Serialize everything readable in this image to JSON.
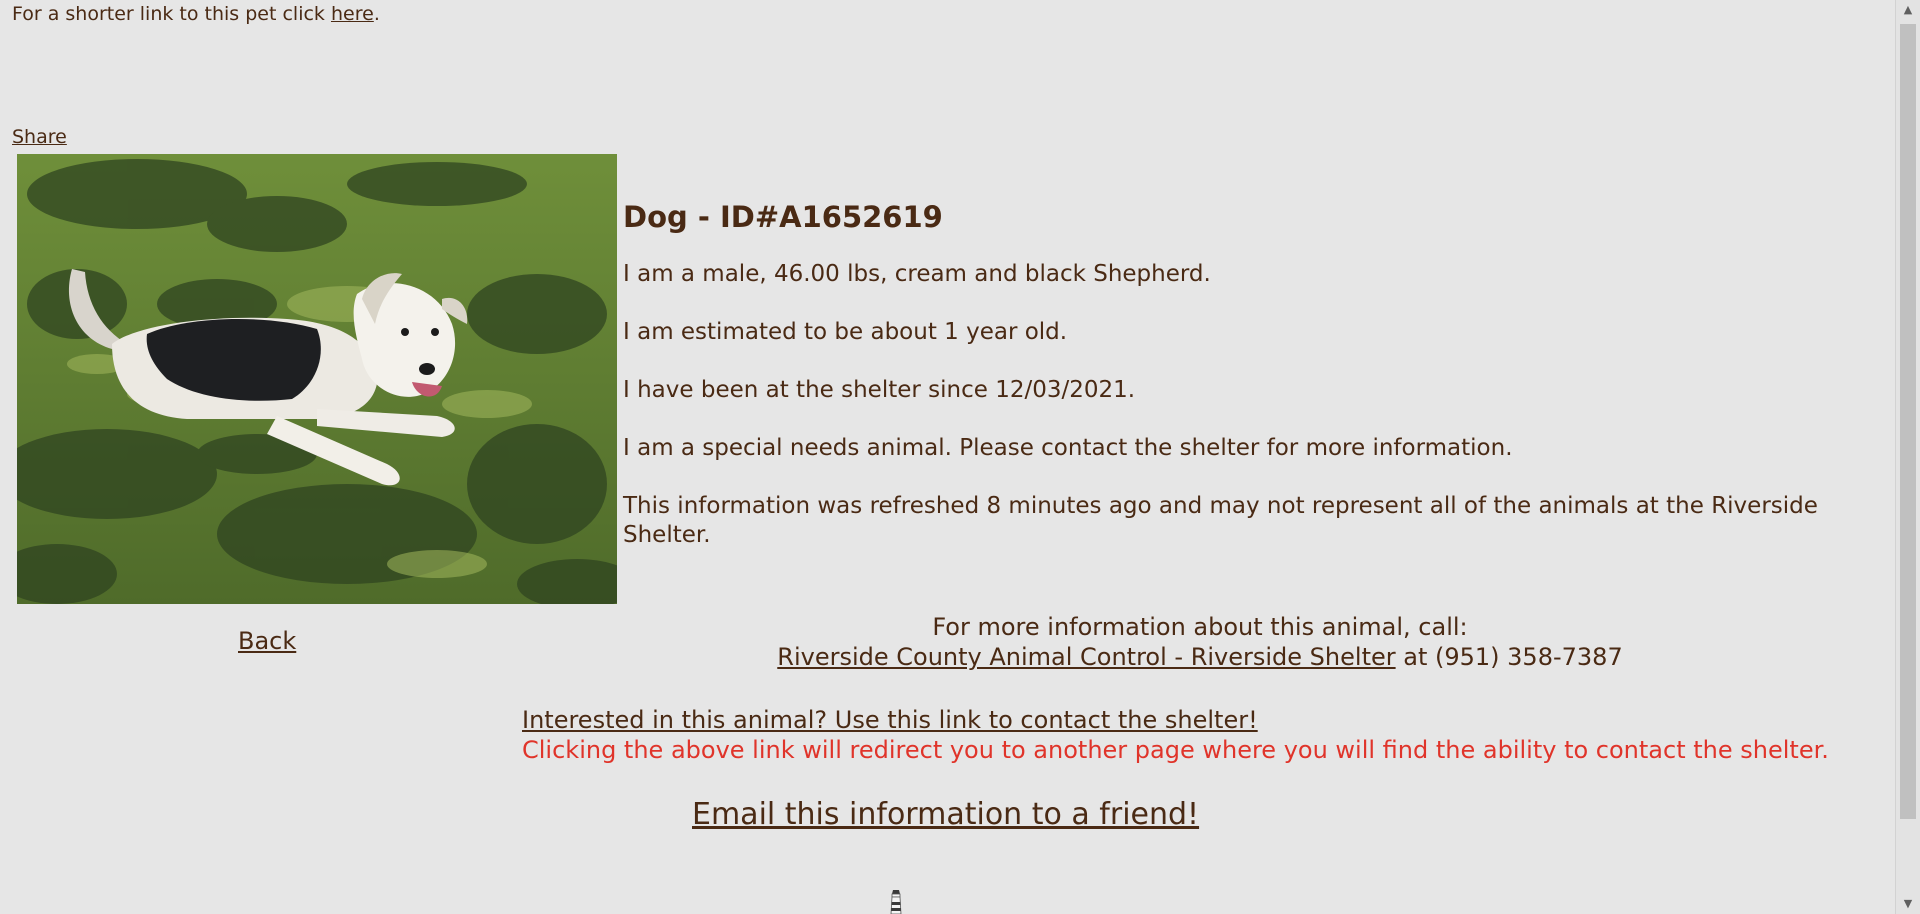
{
  "header": {
    "shortlink_prefix": "For a shorter link to this pet click",
    "shortlink_link": "here",
    "shortlink_suffix": ".",
    "share_label": "Share"
  },
  "animal": {
    "title": "Dog - ID#A1652619",
    "description_1": "I am a male, 46.00 lbs, cream and black Shepherd.",
    "description_2": "I am estimated to be about 1 year old.",
    "description_3": "I have been at the shelter since 12/03/2021.",
    "description_4": "I am a special needs animal. Please contact the shelter for more information.",
    "refresh_note": "This information was refreshed 8 minutes ago and may not represent all of the animals at the Riverside Shelter."
  },
  "nav": {
    "back_label": "Back"
  },
  "contact": {
    "intro": "For more information about this animal, call:",
    "shelter_name": "Riverside County Animal Control - Riverside Shelter",
    "phone_text": "at (951) 358-7387"
  },
  "interest": {
    "link_text": "Interested in this animal? Use this link to contact the shelter!",
    "warning": "Clicking the above link will redirect you to another page where you will find the ability to contact the shelter."
  },
  "email": {
    "link_text": "Email this information to a friend!"
  },
  "icons": {
    "photo": "dog-photo",
    "bottom_icon": "lighthouse-icon",
    "scroll_up": "chevron-up-icon",
    "scroll_down": "chevron-down-icon"
  },
  "colors": {
    "background": "#e6e6e6",
    "text": "#4a2a14",
    "warning": "#e0342a"
  }
}
